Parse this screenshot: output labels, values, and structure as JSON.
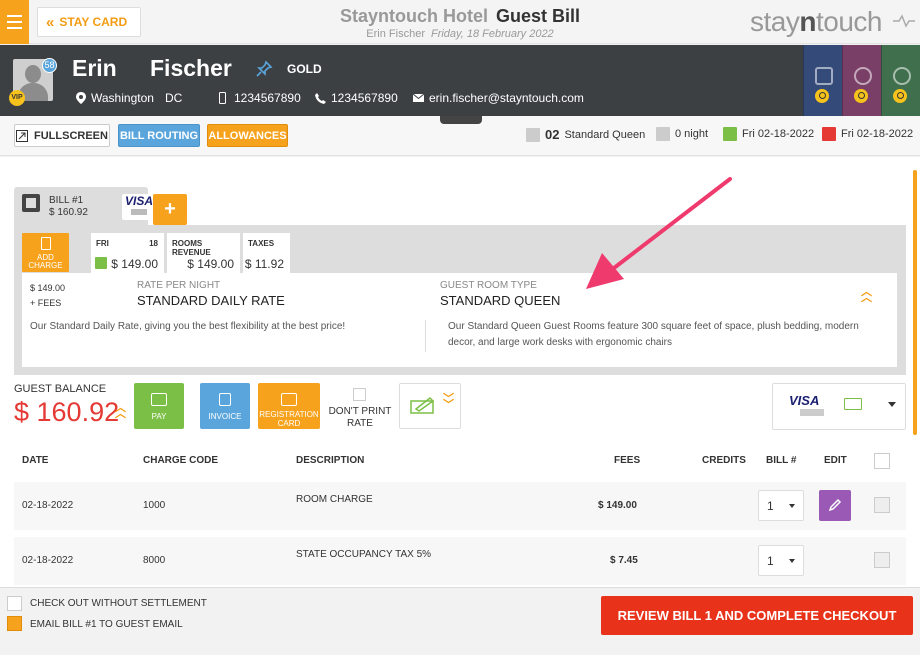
{
  "topbar": {
    "stay_card": "STAY CARD",
    "hotel_name": "Stayntouch Hotel",
    "page_title": "Guest Bill",
    "guest_name": "Erin Fischer",
    "date": "Friday, 18 February 2022",
    "logo_a": "stay",
    "logo_b": "n",
    "logo_c": "touch"
  },
  "guest": {
    "first_name": "Erin",
    "last_name": "Fischer",
    "loyalty": "GOLD",
    "badge_count": "58",
    "vip": "VIP",
    "city": "Washington",
    "state": "DC",
    "mobile": "1234567890",
    "phone": "1234567890",
    "email": "erin.fischer@stayntouch.com"
  },
  "toolbar": {
    "fullscreen": "FULLSCREEN",
    "bill_routing": "BILL ROUTING",
    "allowances": "ALLOWANCES",
    "room_number": "02",
    "room_type": "Standard Queen",
    "nights": "0 night",
    "arrival": "Fri 02-18-2022",
    "departure": "Fri 02-18-2022"
  },
  "bill": {
    "label": "BILL #1",
    "amount": "$ 160.92",
    "card": "VISA",
    "add": "+"
  },
  "rates": {
    "add_charge": "ADD CHARGE",
    "day_label": "FRI",
    "day_num": "18",
    "day_value": "$ 149.00",
    "rooms_revenue_label": "ROOMS REVENUE",
    "rooms_revenue_value": "$ 149.00",
    "taxes_label": "TAXES",
    "taxes_value": "$ 11.92",
    "amount": "$ 149.00",
    "fees": "+ FEES",
    "rate_per_night_label": "RATE PER NIGHT",
    "rate_name": "STANDARD DAILY RATE",
    "rate_desc": "Our Standard Daily Rate, giving you the best flexibility at the best price!",
    "room_type_label": "GUEST ROOM TYPE",
    "room_type": "STANDARD QUEEN",
    "room_desc": "Our Standard Queen Guest Rooms feature 300 square feet of space, plush bedding, modern decor, and large work desks with ergonomic chairs"
  },
  "balance": {
    "label": "GUEST BALANCE",
    "value": "$ 160.92",
    "pay": "PAY",
    "invoice": "INVOICE",
    "registration_card": "REGISTRATION CARD",
    "dont_print_rate": "DON'T PRINT RATE",
    "payment_card": "VISA"
  },
  "table": {
    "headers": [
      "DATE",
      "CHARGE CODE",
      "DESCRIPTION",
      "FEES",
      "CREDITS",
      "BILL #",
      "EDIT"
    ],
    "rows": [
      {
        "date": "02-18-2022",
        "code": "1000",
        "description": "ROOM CHARGE",
        "fees": "$ 149.00",
        "bill": "1"
      },
      {
        "date": "02-18-2022",
        "code": "8000",
        "description": "STATE OCCUPANCY TAX 5%",
        "fees": "$ 7.45",
        "bill": "1"
      }
    ]
  },
  "footer": {
    "checkout_without_settlement": "CHECK OUT WITHOUT SETTLEMENT",
    "email_bill": "EMAIL BILL #1 TO GUEST EMAIL",
    "review_button": "REVIEW BILL 1 AND COMPLETE CHECKOUT"
  },
  "colors": {
    "accent": "#f6a21c",
    "blue": "#5aa6dc",
    "green": "#7cbf46",
    "red": "#e53935",
    "purple": "#9b59b6",
    "review": "#e8321a",
    "arrow": "#ef3a6d"
  }
}
